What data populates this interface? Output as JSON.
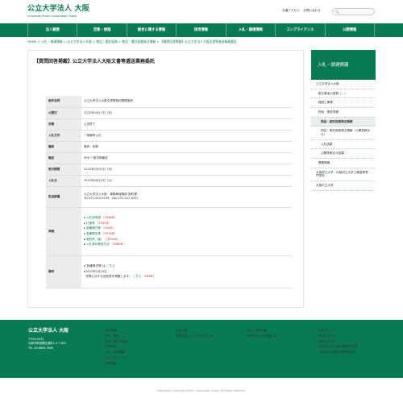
{
  "header": {
    "logo_main": "公立大学法人 大阪",
    "logo_sub": "University Public Corporation Osaka",
    "util_links": [
      "交通アクセス",
      "お問い合わせ"
    ],
    "search_icon": "search-icon"
  },
  "gnav": [
    "法人概要",
    "定款・規程",
    "統合に関する情報",
    "採用情報",
    "入札・調達情報",
    "コンプライアンス",
    "公開情報"
  ],
  "breadcrumb": "HOME > 入札・調達情報 > 公立大学法人大阪 > 物品・委託役務 > 物品・委託役務発注情報 > 【質問回答掲載】公立大学法人大阪文書等逓送業務委託",
  "page_title": "【質問回答掲載】公立大学法人大阪文書等逓送業務委託",
  "table": {
    "rows": [
      {
        "label": "案件名称",
        "value": "公立大学法人大阪文書等逓送業務委託"
      },
      {
        "label": "公開日",
        "value": "2022年1月17日（月）"
      },
      {
        "label": "状態",
        "value": "公告終了"
      },
      {
        "label": "入札方式",
        "value": "一般競争入札"
      },
      {
        "label": "種別",
        "value": "委託・役務"
      },
      {
        "label": "種目",
        "value": "096 一般貨物輸送"
      },
      {
        "label": "受付期限",
        "value": "2022年1月31日（月）"
      },
      {
        "label": "入札日",
        "value": "2022年2月22日（火）"
      }
    ],
    "dept_label": "担当部署",
    "dept_lines": [
      "公立大学法人大阪　事務局総務部 契約課",
      "Tel 072-254-9136　Fax 072-247-6951"
    ],
    "detail_label": "詳細",
    "detail_links": [
      {
        "name": "入札説明書",
        "size": "［336KB］"
      },
      {
        "name": "仕様書",
        "size": "［224KB］"
      },
      {
        "name": "各種様式等",
        "size": "［52KB］"
      },
      {
        "name": "各種規定等",
        "size": "［351KB］"
      },
      {
        "name": "契約書（案）",
        "size": "［361KB］"
      },
      {
        "name": "入札書の郵送方法",
        "size": "［336KB］"
      }
    ],
    "remarks_label": "備考",
    "remarks_line1": "\"各種様式等\"は",
    "remarks_line1_link": "こちら",
    "remarks_line2": "2022年2月10日",
    "remarks_line3": "質問に対する回答書を掲載します。",
    "remarks_line3_link": "こちら",
    "remarks_line3_size": "［96KB］"
  },
  "side": {
    "head": "入札・調達情報",
    "items": [
      {
        "label": "公立大学法人大阪",
        "level": 1,
        "current": false
      },
      {
        "label": "取引業者の登録（…）",
        "level": 2,
        "current": false
      },
      {
        "label": "建設工事等",
        "level": 2,
        "current": false
      },
      {
        "label": "物品・委託役務",
        "level": 2,
        "current": false
      },
      {
        "label": "物品・委託役務発注情報",
        "level": 3,
        "current": true
      },
      {
        "label": "物品・委託役務発注情報（公開見積合せ）",
        "level": 3,
        "current": false
      },
      {
        "label": "入札結果",
        "level": 3,
        "current": false
      },
      {
        "label": "公開見積合せ結果",
        "level": 3,
        "current": false
      },
      {
        "label": "関連情報",
        "level": 2,
        "current": false
      },
      {
        "label": "大阪府立大学・大阪府立大学工業高等専門学校",
        "level": 1,
        "current": false
      },
      {
        "label": "大阪市立大学",
        "level": 1,
        "current": false
      }
    ]
  },
  "footer": {
    "name": "公立大学法人 大阪",
    "addr_lines": [
      "〒545-0051",
      "大阪市阿倍野区旭町1-2-7-601",
      "TEL 06-6645-3640"
    ],
    "col1": [
      "法人概要",
      "定款・規程",
      "統合に関する情報",
      "採用情報",
      "入札・調達情報",
      "コンプライアンス",
      "公開情報"
    ],
    "col2": [
      "教育公募",
      "職員採用（公立大学法人大阪）"
    ],
    "col3": [
      "府大・高専公募",
      "大阪市立大学 事業公募"
    ],
    "col4": [
      "交通アクセス",
      "大阪府立大学",
      "大阪市立大学",
      "大阪府立大学工業高等専門学校",
      "大阪市立大学医学部附属病院"
    ]
  },
  "copyright": "Copyright© University Public Corporation Osaka. All Rights Reserved."
}
